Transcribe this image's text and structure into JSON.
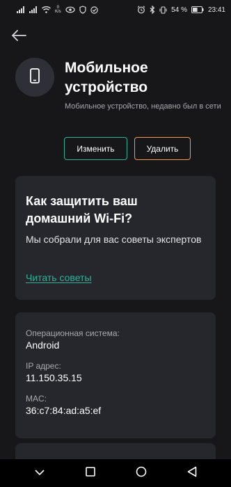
{
  "status_bar": {
    "network_speed_value": "0",
    "network_speed_unit": "K/s",
    "battery": "54 %",
    "time": "23:41",
    "icons": [
      "signal-icon",
      "signal-icon",
      "wifi-icon",
      "eye-icon",
      "shield-icon",
      "vpn-icon",
      "alarm-icon",
      "bluetooth-icon",
      "vibrate-icon",
      "battery-icon"
    ]
  },
  "header": {
    "back_icon": "arrow-left-icon"
  },
  "device": {
    "icon": "smartphone-icon",
    "title": "Мобильное устройство",
    "subtitle": "Мобильное устройство, недавно был в сети",
    "edit_label": "Изменить",
    "delete_label": "Удалить"
  },
  "tips_card": {
    "title": "Как защитить ваш домашний Wi-Fi?",
    "body": "Мы собрали для вас советы экспертов",
    "link": "Читать советы"
  },
  "info_card": {
    "items": [
      {
        "label": "Операционная система:",
        "value": "Android"
      },
      {
        "label": "IP адрес:",
        "value": "11.150.35.15"
      },
      {
        "label": "MAC:",
        "value": "36:c7:84:ad:a5:ef"
      }
    ]
  },
  "nav": {
    "buttons": [
      "collapse-icon",
      "recents-icon",
      "home-icon",
      "back-triangle-icon"
    ]
  },
  "colors": {
    "background": "#17171a",
    "card": "#26272d",
    "accent_green": "#2bb49b",
    "accent_orange": "#f39b41"
  }
}
